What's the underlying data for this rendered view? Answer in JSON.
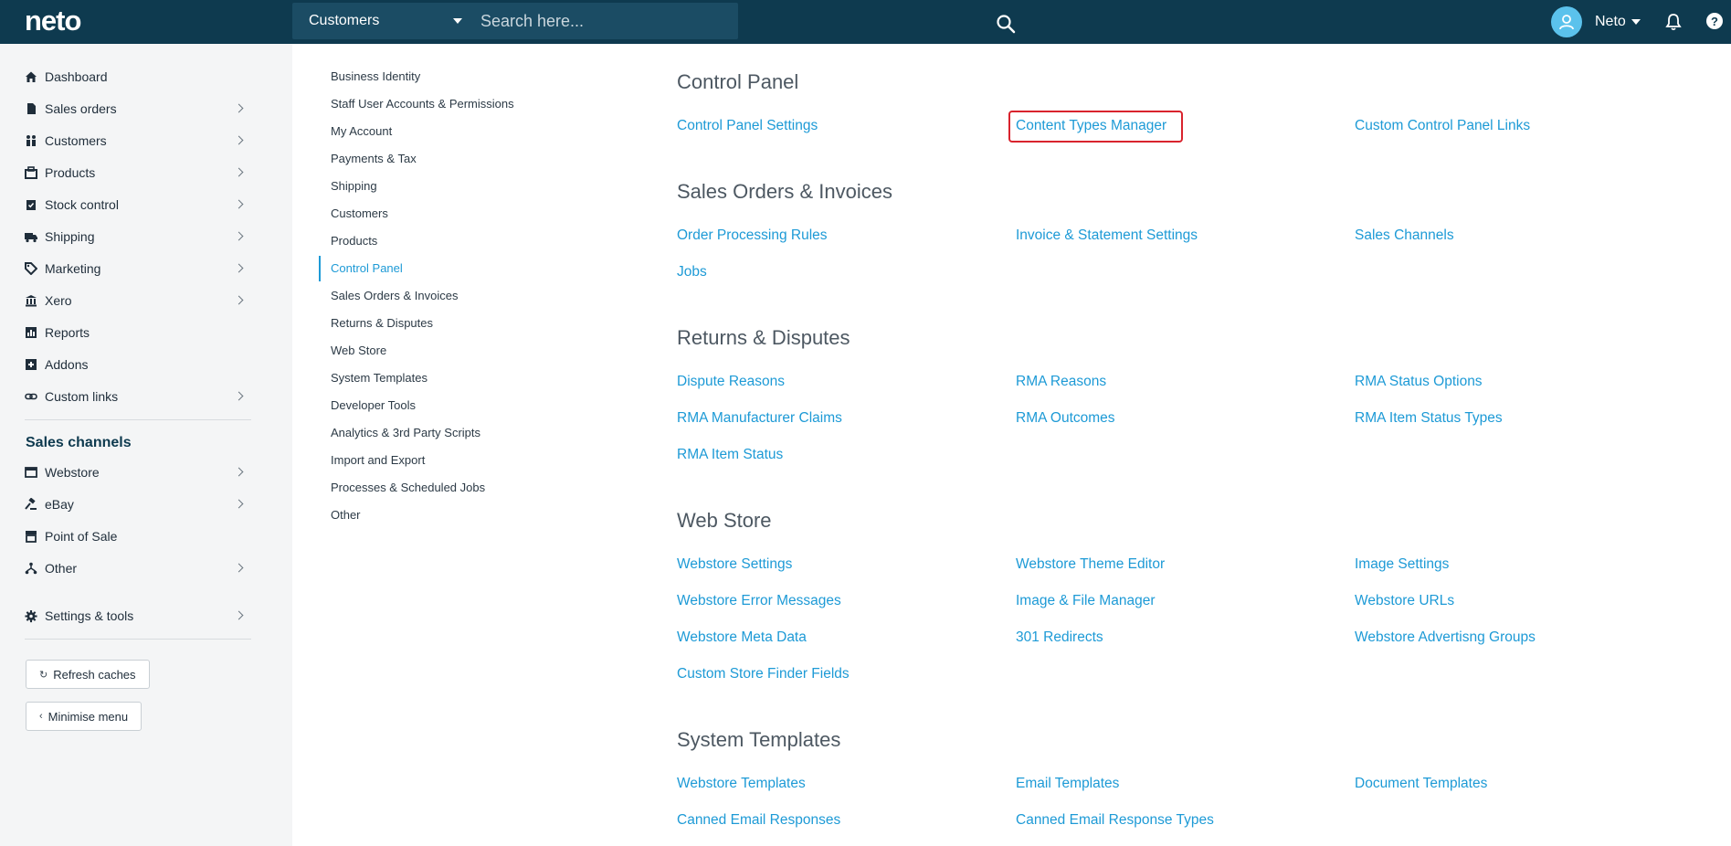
{
  "header": {
    "logo": "neto",
    "search_scope": "Customers",
    "search_placeholder": "Search here...",
    "user_name": "Neto",
    "help_label": "?"
  },
  "sidebar": {
    "items": [
      {
        "label": "Dashboard",
        "icon": "home-icon"
      },
      {
        "label": "Sales orders",
        "icon": "document-icon"
      },
      {
        "label": "Customers",
        "icon": "users-icon"
      },
      {
        "label": "Products",
        "icon": "box-icon"
      },
      {
        "label": "Stock control",
        "icon": "clipboard-check-icon"
      },
      {
        "label": "Shipping",
        "icon": "truck-icon"
      },
      {
        "label": "Marketing",
        "icon": "tag-icon"
      },
      {
        "label": "Xero",
        "icon": "bank-icon"
      },
      {
        "label": "Reports",
        "icon": "bar-chart-icon"
      },
      {
        "label": "Addons",
        "icon": "plus-square-icon"
      },
      {
        "label": "Custom links",
        "icon": "link-icon"
      }
    ],
    "channels_title": "Sales channels",
    "channels": [
      {
        "label": "Webstore",
        "icon": "browser-icon"
      },
      {
        "label": "eBay",
        "icon": "gavel-icon"
      },
      {
        "label": "Point of Sale",
        "icon": "store-icon"
      },
      {
        "label": "Other",
        "icon": "network-icon"
      }
    ],
    "settings_label": "Settings & tools",
    "refresh_label": "Refresh caches",
    "minimise_label": "Minimise menu"
  },
  "subnav": {
    "items": [
      "Business Identity",
      "Staff User Accounts & Permissions",
      "My Account",
      "Payments & Tax",
      "Shipping",
      "Customers",
      "Products",
      "Control Panel",
      "Sales Orders & Invoices",
      "Returns & Disputes",
      "Web Store",
      "System Templates",
      "Developer Tools",
      "Analytics & 3rd Party Scripts",
      "Import and Export",
      "Processes & Scheduled Jobs",
      "Other"
    ],
    "active": "Control Panel"
  },
  "sections": [
    {
      "title": "Control Panel",
      "links": [
        "Control Panel Settings",
        "Content Types Manager",
        "Custom Control Panel Links"
      ]
    },
    {
      "title": "Sales Orders & Invoices",
      "links": [
        "Order Processing Rules",
        "Invoice & Statement Settings",
        "Sales Channels",
        "Jobs"
      ]
    },
    {
      "title": "Returns & Disputes",
      "links": [
        "Dispute Reasons",
        "RMA Reasons",
        "RMA Status Options",
        "RMA Manufacturer Claims",
        "RMA Outcomes",
        "RMA Item Status Types",
        "RMA Item Status"
      ]
    },
    {
      "title": "Web Store",
      "links": [
        "Webstore Settings",
        "Webstore Theme Editor",
        "Image Settings",
        "Webstore Error Messages",
        "Image & File Manager",
        "Webstore URLs",
        "Webstore Meta Data",
        "301 Redirects",
        "Webstore Advertisng Groups",
        "Custom Store Finder Fields"
      ]
    },
    {
      "title": "System Templates",
      "links": [
        "Webstore Templates",
        "Email Templates",
        "Document Templates",
        "Canned Email Responses",
        "Canned Email Response Types"
      ]
    }
  ],
  "highlighted_link": "Content Types Manager",
  "colors": {
    "topbar": "#0e3a4f",
    "link": "#1d9ad6",
    "highlight": "#d9232d",
    "avatar": "#5bc2ec"
  }
}
